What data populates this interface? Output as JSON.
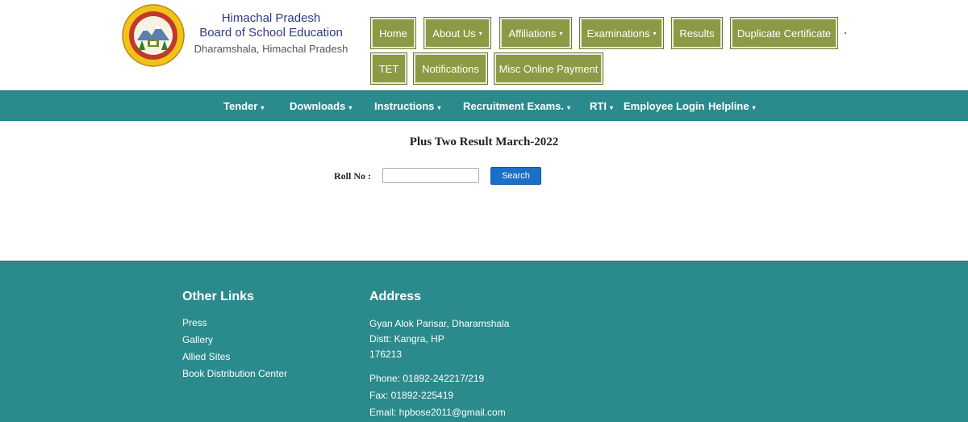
{
  "header": {
    "org_line1": "Himachal Pradesh",
    "org_line2": "Board of School Education",
    "org_line3": "Dharamshala, Himachal Pradesh",
    "nav_row1": [
      {
        "label": "Home"
      },
      {
        "label": "About Us"
      },
      {
        "label": "Affiliations"
      },
      {
        "label": "Examinations"
      },
      {
        "label": "Results"
      },
      {
        "label": "Duplicate Certificate"
      }
    ],
    "nav_row2": [
      {
        "label": "TET"
      },
      {
        "label": "Notifications"
      },
      {
        "label": "Misc Online Payment"
      }
    ],
    "caret": "▾"
  },
  "menubar": {
    "items": [
      {
        "label": "Tender"
      },
      {
        "label": "Downloads"
      },
      {
        "label": "Instructions"
      },
      {
        "label": "Recruitment Exams."
      },
      {
        "label": "RTI"
      },
      {
        "label": "Employee Login"
      },
      {
        "label": "Helpline"
      }
    ]
  },
  "main": {
    "title": "Plus Two Result March-2022",
    "roll_label": "Roll No :",
    "roll_value": "",
    "search_label": "Search"
  },
  "footer": {
    "other_links_heading": "Other Links",
    "other_links": [
      "Press",
      "Gallery",
      "Allied Sites",
      "Book Distribution Center"
    ],
    "address_heading": "Address",
    "address_lines": [
      "Gyan Alok Parisar, Dharamshala",
      "Distt: Kangra, HP",
      "176213"
    ],
    "phone": "Phone: 01892-242217/219",
    "fax": "Fax: 01892-225419",
    "email": "Email: hpbose2011@gmail.com"
  },
  "colors": {
    "nav_olive": "#8c9a45",
    "teal": "#2b8a8c",
    "org_blue": "#2d3a86",
    "search_blue": "#1a6fc9"
  }
}
